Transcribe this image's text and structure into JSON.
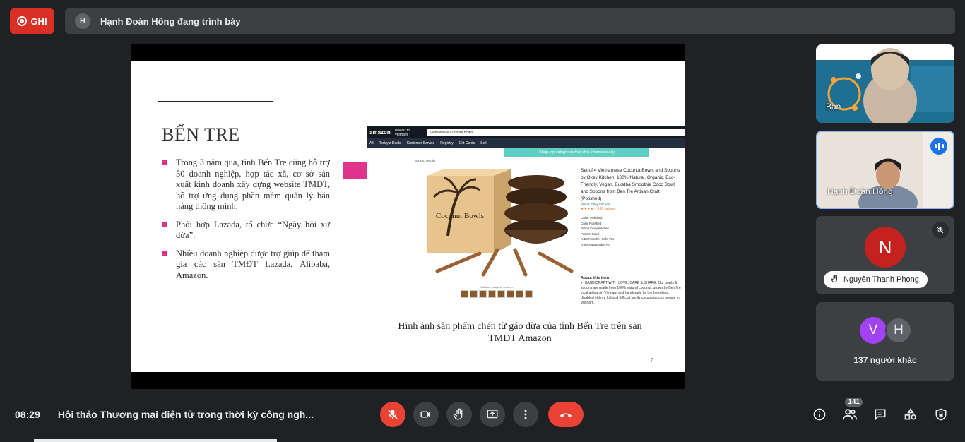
{
  "header": {
    "record_label": "GHI",
    "presenter_initial": "H",
    "presenting_text": "Hạnh Đoàn Hồng đang trình bày"
  },
  "slide": {
    "title": "BẾN TRE",
    "bullets": [
      "Trong 3 năm qua, tỉnh Bến Tre cũng hỗ trợ 50 doanh nghiệp, hợp tác xã, cơ sở sản xuất kinh doanh xây dựng website TMĐT, hỗ trợ ứng dụng phần mềm quản lý bán hàng thông minh.",
      "Phối hợp Lazada, tổ chức “Ngày hội xứ dừa”.",
      "Nhiều doanh nghiệp được trợ giúp để tham gia các sàn TMĐT Lazada, Alibaba, Amazon."
    ],
    "caption": "Hình ảnh sản phẩm chén từ gáo dừa của tỉnh Bến Tre trên sàn TMĐT Amazon",
    "page_number": "7",
    "amazon": {
      "logo": "amazon",
      "deliver": "Deliver to Vietnam",
      "search": "Vietnamese Coconut Bowls",
      "nav": [
        "All",
        "Today's Deals",
        "Customer Service",
        "Registry",
        "Gift Cards",
        "Sell"
      ],
      "banner": "Shop top categories that ship internationally",
      "back": "‹ Back to results",
      "product_title": "Set of 4 Vietnamese Coconut Bowls and Spoons by Okey Kitchen, 100% Natural, Organic, Eco-Friendly, Vegan, Buddha Smoothie Coco Bowl and Spoons from Ben Tre Artisan Craft (Polished)",
      "brand": "Brand: Okey Kitchen",
      "ratings": "★★★★☆ 100 ratings",
      "specs": "Color: Polished\nColor   Polished\nBrand   Okey Kitchen\nPattern   Solid\nIs Dishwasher Safe   Yes\nIs Microwaveable   No",
      "about_title": "About this item",
      "about_text": "✓ HANDICRAFT WITH LOVE, CARE & SHARE: Our bowls & spoons are made from 100% natural coconut, grown by Ben Tre local artisan in Vietnam and handmade by the homeless, disabled elderly, kid and difficult family circumstances people in Vietnam.",
      "roll_over": "Roll over image to zoom in",
      "box_text": "Coconut Bowls"
    }
  },
  "participants": {
    "self_label": "Bạn",
    "speaker_name": "Hạnh Đoàn Hồng",
    "muted_initial": "N",
    "muted_name": "Nguyễn Thanh Phong",
    "others_initials": [
      "V",
      "H"
    ],
    "others_label": "137 người khác"
  },
  "footer": {
    "time": "08:29",
    "meeting_title": "Hội thảo Thương mại điện tử trong thời kỳ công ngh...",
    "people_count": "141"
  },
  "colors": {
    "record_red": "#d93025",
    "end_call_red": "#ea4335",
    "bullet_pink": "#d6338a",
    "speaker_border": "#8ab4f8"
  }
}
